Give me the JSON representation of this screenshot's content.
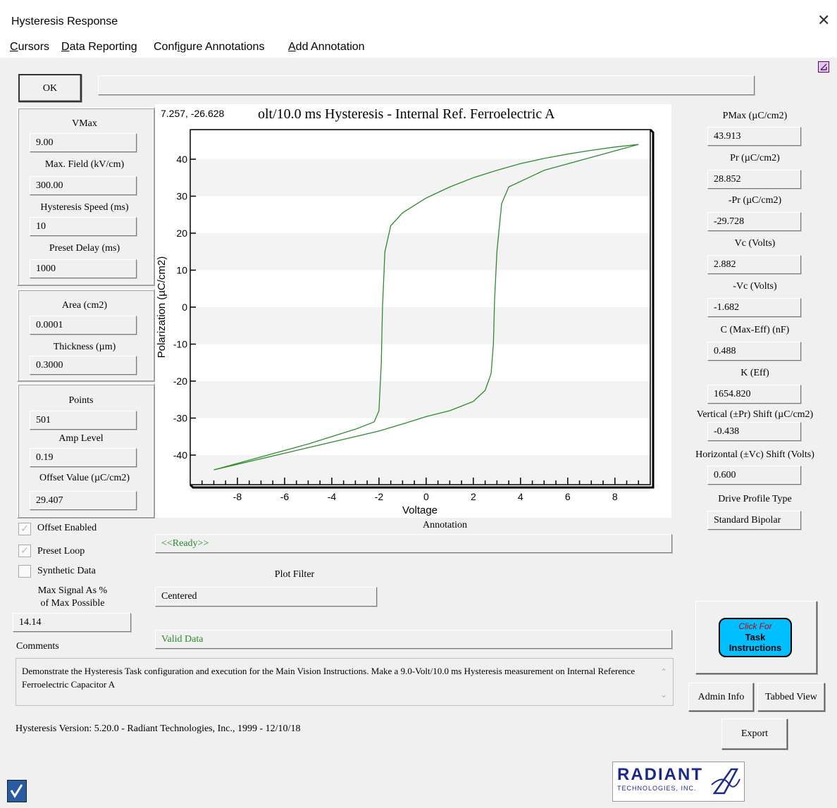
{
  "window": {
    "title": "Hysteresis Response",
    "close_glyph": "✕"
  },
  "menu": [
    {
      "key": "C",
      "rest": "ursors"
    },
    {
      "key": "D",
      "rest": "ata Reporting"
    },
    {
      "key": "i",
      "pre": "Conf",
      "rest": "gure Annotations"
    },
    {
      "key": "A",
      "rest": "dd Annotation"
    }
  ],
  "ok_label": "OK",
  "left_params": {
    "vmax_label": "VMax",
    "vmax": "9.00",
    "maxfield_label": "Max. Field (kV/cm)",
    "maxfield": "300.00",
    "speed_label": "Hysteresis Speed (ms)",
    "speed": "10",
    "delay_label": "Preset Delay (ms)",
    "delay": "1000",
    "area_label": "Area (cm2)",
    "area": "0.0001",
    "thickness_label": "Thickness (µm)",
    "thickness": "0.3000",
    "points_label": "Points",
    "points": "501",
    "amp_label": "Amp Level",
    "amp": "0.19",
    "offset_label": "Offset Value (µC/cm2)",
    "offset": "29.407"
  },
  "checks": {
    "offset_enabled": "Offset Enabled",
    "preset_loop": "Preset Loop",
    "synthetic": "Synthetic Data",
    "check_glyph": "✓"
  },
  "max_signal_label_1": "Max Signal As %",
  "max_signal_label_2": "of Max Possible",
  "max_signal": "14.14",
  "comments_label": "Comments",
  "comments": "Demonstrate the Hysteresis Task configuration and execution for the Main Vision Instructions. Make a 9.0-Volt/10.0 ms Hysteresis measurement on Internal Reference Ferroelectric Capacitor A",
  "version": "Hysteresis Version: 5.20.0 - Radiant Technologies, Inc., 1999 - 12/10/18",
  "annotation_label": "Annotation",
  "annotation": "<<Ready>>",
  "plot_filter_label": "Plot Filter",
  "plot_filter": "Centered",
  "status": "Valid Data",
  "right_params": [
    {
      "label": "PMax (µC/cm2)",
      "value": "43.913"
    },
    {
      "label": "Pr (µC/cm2)",
      "value": "28.852"
    },
    {
      "label": "-Pr (µC/cm2)",
      "value": "-29.728"
    },
    {
      "label": "Vc (Volts)",
      "value": "2.882"
    },
    {
      "label": "-Vc (Volts)",
      "value": "-1.682"
    },
    {
      "label": "C (Max-Eff) (nF)",
      "value": "0.488"
    },
    {
      "label": "K (Eff)",
      "value": "1654.820"
    },
    {
      "label": "Vertical (±Pr) Shift (µC/cm2)",
      "value": "-0.438"
    },
    {
      "label": "Horizontal (±Vc) Shift (Volts)",
      "value": "0.600"
    },
    {
      "label": "Drive Profile Type",
      "value": "Standard Bipolar"
    }
  ],
  "task_btn": {
    "line1": "Click For",
    "line2": "Task",
    "line3": "Instructions"
  },
  "admin_label": "Admin Info",
  "tabbed_label": "Tabbed View",
  "export_label": "Export",
  "logo": {
    "word": "RADIANT",
    "sub": "TECHNOLOGIES, INC."
  },
  "colors": {
    "trace": "#2e8b2e",
    "status_text": "#2a8a2a",
    "task_btn": "#00bfff",
    "logo": "#1a2a8a"
  },
  "chart_data": {
    "type": "line",
    "title": "olt/10.0 ms Hysteresis - Internal Ref. Ferroelectric A",
    "cursor_readout": "7.257, -26.628",
    "xlabel": "Voltage",
    "ylabel": "Polarization (µC/cm2)",
    "xlim": [
      -10,
      9.5
    ],
    "ylim": [
      -48,
      48
    ],
    "xticks": [
      -8,
      -6,
      -4,
      -2,
      0,
      2,
      4,
      6,
      8
    ],
    "yticks": [
      -40,
      -30,
      -20,
      -10,
      0,
      10,
      20,
      30,
      40
    ],
    "grid": "horizontal bands",
    "series": [
      {
        "x": [
          9.0,
          7.0,
          5.0,
          3.5,
          3.2,
          3.0,
          2.9,
          2.85,
          2.75,
          2.5,
          2.0,
          1.0,
          0.0,
          -1.0,
          -2.0,
          -3.0,
          -4.0,
          -5.0,
          -6.0,
          -7.0,
          -8.0,
          -9.0
        ],
        "y": [
          44.0,
          40.5,
          37.0,
          32.5,
          28.0,
          15.0,
          2.0,
          -10.0,
          -18.0,
          -22.5,
          -25.5,
          -28.0,
          -29.6,
          -31.6,
          -33.5,
          -35.0,
          -36.5,
          -38.0,
          -39.5,
          -41.0,
          -42.5,
          -44.0
        ]
      },
      {
        "x": [
          -9.0,
          -7.0,
          -5.0,
          -3.0,
          -2.2,
          -2.0,
          -1.9,
          -1.85,
          -1.75,
          -1.5,
          -1.0,
          0.0,
          1.0,
          2.0,
          3.0,
          4.0,
          5.0,
          6.0,
          7.0,
          8.0,
          9.0
        ],
        "y": [
          -44.0,
          -40.5,
          -37.0,
          -33.0,
          -31.0,
          -28.0,
          -15.0,
          0.0,
          15.0,
          22.0,
          25.5,
          29.5,
          32.5,
          35.0,
          37.0,
          38.8,
          40.2,
          41.4,
          42.4,
          43.3,
          44.0
        ]
      }
    ]
  }
}
